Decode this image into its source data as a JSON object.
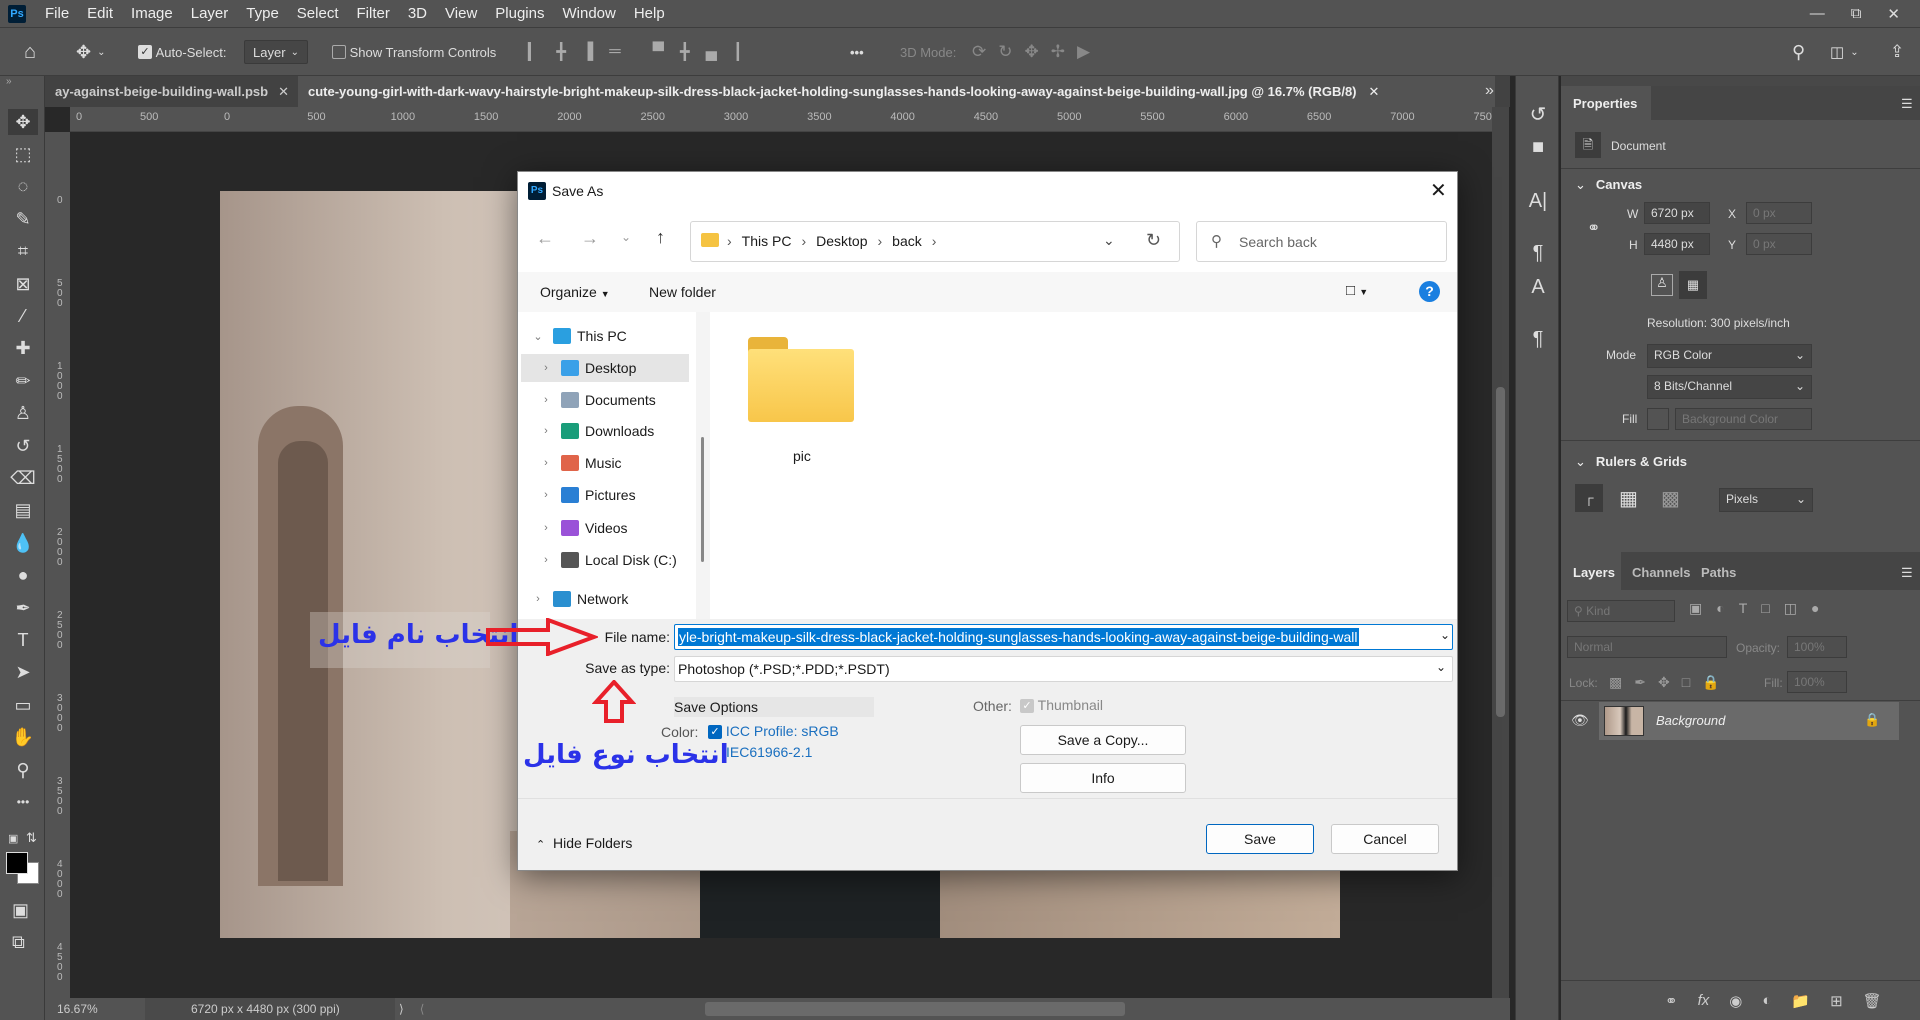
{
  "menu": {
    "logo": "Ps",
    "items": [
      "File",
      "Edit",
      "Image",
      "Layer",
      "Type",
      "Select",
      "Filter",
      "3D",
      "View",
      "Plugins",
      "Window",
      "Help"
    ]
  },
  "options": {
    "auto_select_label": "Auto-Select:",
    "auto_select_checked": true,
    "layer_select": "Layer",
    "show_transform_label": "Show Transform Controls",
    "more": "•••",
    "mode_3d_label": "3D Mode:"
  },
  "tabs": [
    {
      "label": "ay-against-beige-building-wall.psb",
      "active": false
    },
    {
      "label": "cute-young-girl-with-dark-wavy-hairstyle-bright-makeup-silk-dress-black-jacket-holding-sunglasses-hands-looking-away-against-beige-building-wall.jpg @ 16.7% (RGB/8)",
      "active": true
    }
  ],
  "ruler_top": [
    "0",
    "500",
    "0",
    "500",
    "1000",
    "1500",
    "2000",
    "2500",
    "3000",
    "3500",
    "4000",
    "4500",
    "5000",
    "5500",
    "6000",
    "6500",
    "7000",
    "750"
  ],
  "ruler_left": [
    "0",
    "500",
    "1000",
    "1500",
    "2000",
    "2500",
    "3000",
    "3500",
    "4000",
    "4500"
  ],
  "status": {
    "zoom": "16.67%",
    "doc_info": "6720 px x 4480 px (300 ppi)"
  },
  "tools": [
    "move",
    "rectangular-marquee",
    "lasso",
    "quick-selection",
    "crop",
    "frame",
    "eyedropper",
    "spot-healing",
    "brush",
    "clone-stamp",
    "history-brush",
    "eraser",
    "gradient",
    "blur",
    "dodge",
    "pen",
    "type",
    "path-selection",
    "rectangle",
    "hand",
    "zoom",
    "more-tools"
  ],
  "colors": {
    "foreground": "#000000",
    "background": "#ffffff",
    "accent": "#0078d4",
    "annotation_text": "#2b32e8",
    "annotation_arrow": "#e8202a"
  },
  "properties": {
    "tab": "Properties",
    "document_label": "Document",
    "canvas_section": "Canvas",
    "w_label": "W",
    "w_value": "6720 px",
    "h_label": "H",
    "h_value": "4480 px",
    "x_label": "X",
    "x_value": "0 px",
    "y_label": "Y",
    "y_value": "0 px",
    "resolution": "Resolution: 300 pixels/inch",
    "mode_label": "Mode",
    "mode_value": "RGB Color",
    "bits_value": "8 Bits/Channel",
    "fill_label": "Fill",
    "fill_value": "Background Color",
    "rulers_section": "Rulers & Grids",
    "units_value": "Pixels"
  },
  "layers": {
    "tabs": [
      "Layers",
      "Channels",
      "Paths"
    ],
    "kind_placeholder": "Kind",
    "blend_mode": "Normal",
    "opacity_label": "Opacity:",
    "opacity_value": "100%",
    "lock_label": "Lock:",
    "fill_label": "Fill:",
    "fill_value": "100%",
    "items": [
      {
        "name": "Background",
        "visible": true,
        "locked": true
      }
    ]
  },
  "dialog": {
    "title": "Save As",
    "breadcrumb": [
      "This PC",
      "Desktop",
      "back"
    ],
    "search_placeholder": "Search back",
    "organize": "Organize",
    "new_folder": "New folder",
    "nav": [
      {
        "label": "This PC",
        "expanded": true,
        "level": 0,
        "color": "#2a9fe0"
      },
      {
        "label": "Desktop",
        "selected": true,
        "level": 1,
        "color": "#3aa0e8"
      },
      {
        "label": "Documents",
        "level": 1,
        "color": "#8fa3b8"
      },
      {
        "label": "Downloads",
        "level": 1,
        "color": "#1a9d7a"
      },
      {
        "label": "Music",
        "level": 1,
        "color": "#e0644a"
      },
      {
        "label": "Pictures",
        "level": 1,
        "color": "#2a7fd4"
      },
      {
        "label": "Videos",
        "level": 1,
        "color": "#9a52d8"
      },
      {
        "label": "Local Disk (C:)",
        "level": 1,
        "color": "#555555"
      },
      {
        "label": "Network",
        "level": 0,
        "color": "#2a8fd0"
      }
    ],
    "files": [
      {
        "name": "pic",
        "type": "folder"
      }
    ],
    "file_name_label": "File name:",
    "file_name_value": "yle-bright-makeup-silk-dress-black-jacket-holding-sunglasses-hands-looking-away-against-beige-building-wall",
    "save_type_label": "Save as type:",
    "save_type_value": "Photoshop (*.PSD;*.PDD;*.PSDT)",
    "save_options": "Save Options",
    "color_label": "Color:",
    "icc_label": "ICC Profile:  sRGB",
    "icc_line2": "IEC61966-2.1",
    "icc_checked": true,
    "other_label": "Other:",
    "thumbnail_label": "Thumbnail",
    "thumbnail_checked": true,
    "save_copy": "Save a Copy...",
    "info": "Info",
    "hide_folders": "Hide Folders",
    "save": "Save",
    "cancel": "Cancel"
  },
  "annotations": {
    "file_name": "انتخاب نام فایل",
    "file_type": "انتخاب نوع فایل"
  }
}
